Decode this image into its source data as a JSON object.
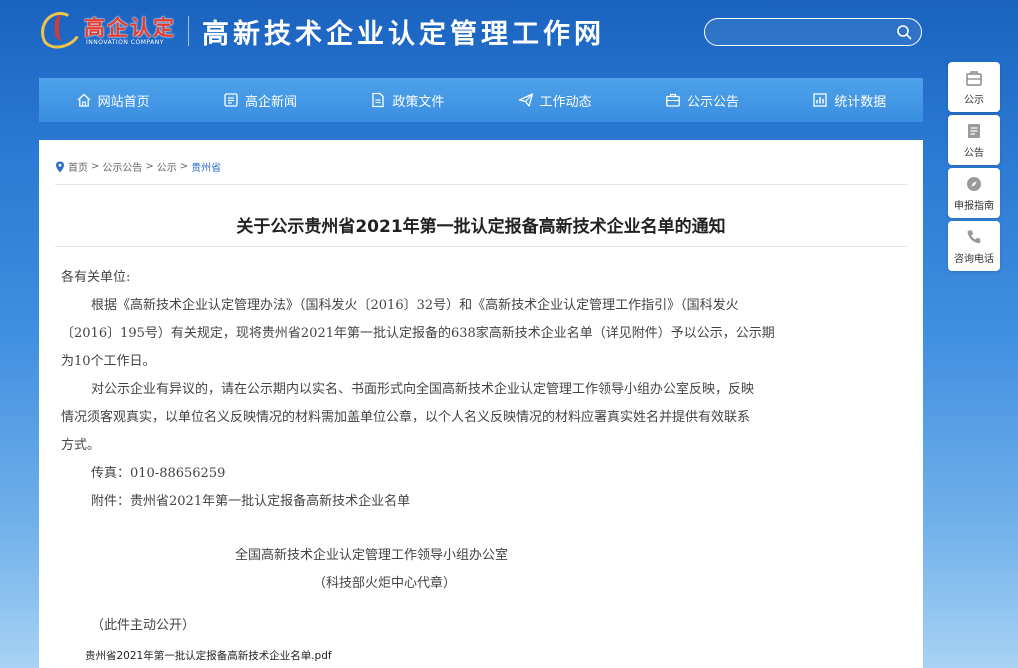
{
  "header": {
    "logo_cn": "高企认定",
    "logo_en": "INNOVATION COMPANY",
    "site_title": "高新技术企业认定管理工作网",
    "search_placeholder": ""
  },
  "nav": {
    "items": [
      {
        "label": "网站首页",
        "icon": "home-icon"
      },
      {
        "label": "高企新闻",
        "icon": "news-icon"
      },
      {
        "label": "政策文件",
        "icon": "document-icon"
      },
      {
        "label": "工作动态",
        "icon": "paper-plane-icon"
      },
      {
        "label": "公示公告",
        "icon": "briefcase-icon"
      },
      {
        "label": "统计数据",
        "icon": "chart-icon"
      }
    ]
  },
  "breadcrumb": {
    "home": "首页",
    "sep": ">",
    "level1": "公示公告",
    "level2": "公示",
    "current": "贵州省"
  },
  "article": {
    "title": "关于公示贵州省2021年第一批认定报备高新技术企业名单的通知",
    "salutation": "各有关单位:",
    "para1_line1": "根据《高新技术企业认定管理办法》（国科发火〔2016〕32号）和《高新技术企业认定管理工作指引》（国科发火",
    "para1_line2": "〔2016〕195号）有关规定，现将贵州省2021年第一批认定报备的638家高新技术企业名单（详见附件）予以公示，公示期",
    "para1_line3": "为10个工作日。",
    "para2_line1": "对公示企业有异议的，请在公示期内以实名、书面形式向全国高新技术企业认定管理工作领导小组办公室反映，反映",
    "para2_line2": "情况须客观真实，以单位名义反映情况的材料需加盖单位公章，以个人名义反映情况的材料应署真实姓名并提供有效联系",
    "para2_line3": "方式。",
    "fax": "传真：010-88656259",
    "attachment": "附件：贵州省2021年第一批认定报备高新技术企业名单",
    "signature_org": "全国高新技术企业认定管理工作领导小组办公室",
    "signature_sub": "（科技部火炬中心代章）",
    "public_note": "（此件主动公开）",
    "pdf_link": "贵州省2021年第一批认定报备高新技术企业名单.pdf"
  },
  "side_tools": [
    {
      "label": "公示",
      "icon": "briefcase-icon"
    },
    {
      "label": "公告",
      "icon": "notice-icon"
    },
    {
      "label": "申报指南",
      "icon": "compass-icon"
    },
    {
      "label": "咨询电话",
      "icon": "phone-icon"
    }
  ],
  "colors": {
    "nav_bg": "#4a9be6",
    "logo_red": "#e43d30",
    "link_blue": "#2a6cc8"
  }
}
